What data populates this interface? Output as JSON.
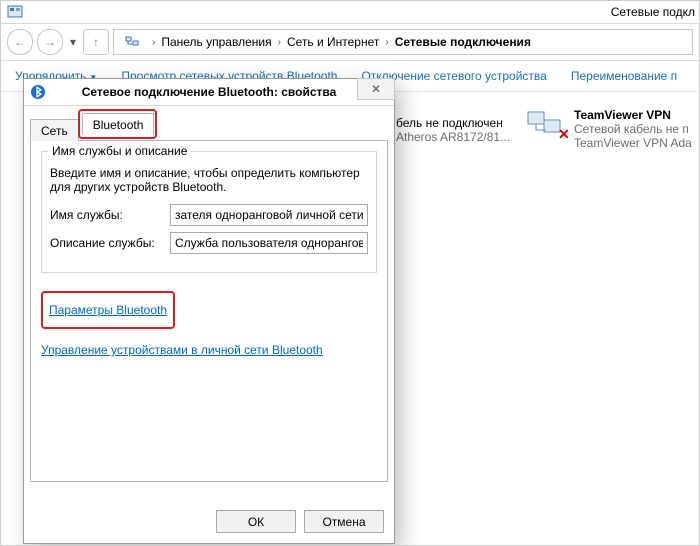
{
  "titlebar": {
    "title": "Сетевые подкл"
  },
  "breadcrumb": {
    "seg1": "Панель управления",
    "seg2": "Сеть и Интернет",
    "seg3": "Сетевые подключения"
  },
  "cmdbar": {
    "organize": "Упорядочить",
    "view_bt": "Просмотр сетевых устройств Bluetooth",
    "disable": "Отключение сетевого устройства",
    "rename": "Переименование п"
  },
  "underlay": {
    "row1": "бель не подключен",
    "row2": "Atheros AR8172/81..."
  },
  "vpn": {
    "name": "TeamViewer VPN",
    "status": "Сетевой кабель не п",
    "adapter": "TeamViewer VPN Ada"
  },
  "dialog": {
    "title": "Сетевое подключение Bluetooth: свойства",
    "tab_net": "Сеть",
    "tab_bt": "Bluetooth",
    "group_title": "Имя службы и описание",
    "group_desc": "Введите имя и описание, чтобы определить компьютер для других устройств Bluetooth.",
    "label_name": "Имя службы:",
    "label_desc": "Описание службы:",
    "value_name": "зателя одноранговой личной сети",
    "value_desc": "Служба пользователя одноранговс",
    "link_params": "Параметры Bluetooth",
    "link_manage": "Управление устройствами в личной сети Bluetooth",
    "ok": "ОК",
    "cancel": "Отмена"
  }
}
